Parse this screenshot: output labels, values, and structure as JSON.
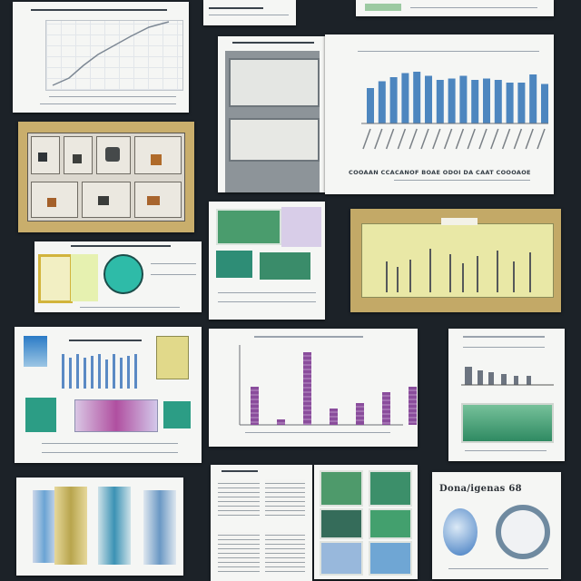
{
  "board": {
    "background": "#1c2228"
  },
  "cards": {
    "bar_report": {
      "caption": "COOAAN CCACANOF BOAE ODOI DA CAAT COOOAOE"
    },
    "document": {
      "heading": "Dona/igenas 68"
    }
  },
  "colors": {
    "blue_bar": "#4d86bf",
    "purple_bar": "#8a4d9c",
    "teal": "#33b3a6",
    "olive": "#b9bf74",
    "tan": "#c9ae6c"
  },
  "chart_data": [
    {
      "type": "bar",
      "values": [
        52,
        62,
        68,
        74,
        76,
        70,
        64,
        66,
        70,
        64,
        66,
        64,
        60,
        60,
        72,
        58
      ]
    },
    {
      "type": "bar",
      "values": [
        42,
        6,
        80,
        18,
        24,
        36,
        42
      ]
    }
  ]
}
